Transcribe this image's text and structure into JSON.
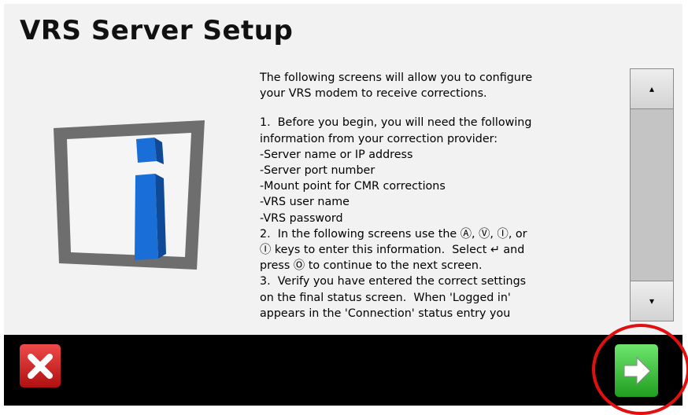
{
  "header": {
    "title": "VRS Server Setup"
  },
  "content": {
    "lines": [
      "The following screens will allow you to configure",
      "your VRS modem to receive corrections.",
      "1.  Before you begin, you will need the following",
      "information from your correction provider:",
      "-Server name or IP address",
      "-Server port number",
      "-Mount point for CMR corrections",
      "-VRS user name",
      "-VRS password",
      "2.  In the following screens use the Ⓐ, Ⓥ, Ⓘ, or",
      "Ⓘ keys to enter this information.  Select ↵ and",
      "press Ⓞ to continue to the next screen.",
      "3.  Verify you have entered the correct settings",
      "on the final status screen.  When 'Logged in'",
      "appears in the 'Connection' status entry you"
    ]
  },
  "scrollbar": {
    "up_icon": "▴",
    "down_icon": "▾"
  },
  "footer": {
    "cancel_icon": "close-icon",
    "next_icon": "arrow-right-icon"
  },
  "colors": {
    "cancel": "#d42a2a",
    "next": "#3cc43c",
    "highlight": "#e01010",
    "footer": "#000000"
  }
}
